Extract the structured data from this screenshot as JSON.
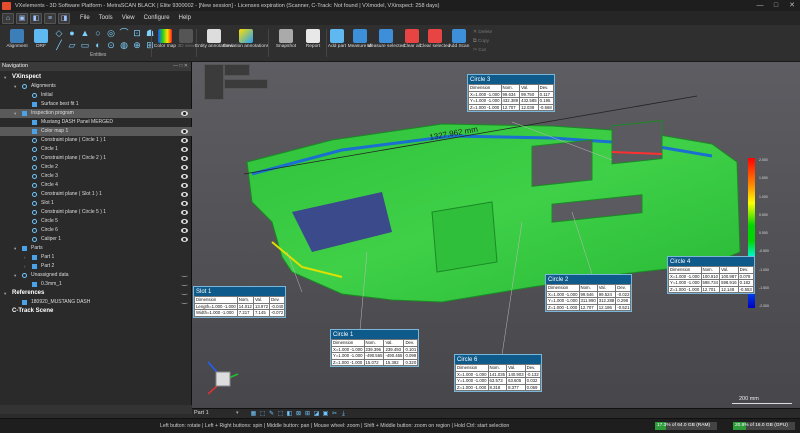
{
  "titlebar": {
    "title": "VXelements - 3D Software Platform - MetraSCAN BLACK | Elite 9300002 - [New session] - Licenses expiration (Scanner, C-Track: Not found | VXmodel, VXinspect: 258 days)",
    "minimize": "—",
    "maximize": "□",
    "close": "✕"
  },
  "menubar": {
    "items": [
      "File",
      "Tools",
      "View",
      "Configure",
      "Help"
    ],
    "quick": [
      "⌂",
      "▣",
      "◧",
      "≡",
      "◨"
    ]
  },
  "ribbon": {
    "alignment": "Alignment",
    "drf": "DRF",
    "entities_group": "Entities",
    "color_map": "Color map",
    "view_3d": "3D view",
    "entity_annotations": "Entity annotations",
    "deviation_annotations": "Deviation annotations",
    "snapshot": "Snapshot",
    "report": "Report",
    "add_part": "Add part",
    "measure_all": "Measure all",
    "measure_selected": "Measure selected",
    "clear_all": "Clear all",
    "clear_selected": "Clear selected",
    "add_scan": "Add Scan",
    "delete": "Delete",
    "copy": "Copy",
    "cut": "Cut",
    "entity_glyphs": [
      "◇",
      "●",
      "▲",
      "○",
      "◎",
      "⌒",
      "⊡",
      "☗",
      "╱",
      "▱",
      "▭",
      "◐",
      "⊙",
      "◍",
      "⊕",
      "⊞"
    ],
    "colors": {
      "accent": "#5fb8f0",
      "clear": "#e84444"
    }
  },
  "nav": {
    "header": "Navigation",
    "controls": "— □ ✕",
    "rows": [
      {
        "label": "VXinspect",
        "bold": true,
        "depth": 0,
        "arrow": "▾"
      },
      {
        "label": "Alignments",
        "depth": 1,
        "arrow": "▾",
        "icon": "dot"
      },
      {
        "label": "Initial",
        "depth": 2,
        "icon": "dot"
      },
      {
        "label": "Surface best fit 1",
        "depth": 2,
        "icon": "sq"
      },
      {
        "label": "Inspection program",
        "depth": 1,
        "arrow": "▾",
        "icon": "sq",
        "eye": "eye",
        "selected": true
      },
      {
        "label": "Mustang DASH Panel MERGED",
        "depth": 2,
        "icon": "sq"
      },
      {
        "label": "Color map 1",
        "depth": 2,
        "icon": "sq",
        "eye": "eye",
        "selected": true
      },
      {
        "label": "Constraint plane ( Circle 1 ) 1",
        "depth": 2,
        "icon": "dot",
        "eye": "eye"
      },
      {
        "label": "Circle 1",
        "depth": 2,
        "icon": "dot",
        "eye": "eye"
      },
      {
        "label": "Constraint plane ( Circle 2 ) 1",
        "depth": 2,
        "icon": "dot",
        "eye": "eye"
      },
      {
        "label": "Circle 2",
        "depth": 2,
        "icon": "dot",
        "eye": "eye"
      },
      {
        "label": "Circle 3",
        "depth": 2,
        "icon": "dot",
        "eye": "eye"
      },
      {
        "label": "Circle 4",
        "depth": 2,
        "icon": "dot",
        "eye": "eye"
      },
      {
        "label": "Constraint plane ( Slot 1 ) 1",
        "depth": 2,
        "icon": "dot",
        "eye": "eye"
      },
      {
        "label": "Slot 1",
        "depth": 2,
        "icon": "dot",
        "eye": "eye"
      },
      {
        "label": "Constraint plane ( Circle 5 ) 1",
        "depth": 2,
        "icon": "dot",
        "eye": "eye"
      },
      {
        "label": "Circle 5",
        "depth": 2,
        "icon": "dot",
        "eye": "eye"
      },
      {
        "label": "Circle 6",
        "depth": 2,
        "icon": "dot",
        "eye": "eye"
      },
      {
        "label": "Caliper 1",
        "depth": 2,
        "icon": "dot",
        "eye": "eye"
      },
      {
        "label": "Parts",
        "depth": 1,
        "arrow": "▾",
        "icon": "sq"
      },
      {
        "label": "Part 1",
        "depth": 2,
        "icon": "sq",
        "arrow": "›"
      },
      {
        "label": "Part 2",
        "depth": 2,
        "icon": "sq",
        "arrow": "›"
      },
      {
        "label": "Unassigned data",
        "depth": 1,
        "arrow": "▾",
        "icon": "dot",
        "eye": "hid"
      },
      {
        "label": "0.3mm_1",
        "depth": 2,
        "icon": "sq",
        "eye": "hid"
      },
      {
        "label": "References",
        "bold": true,
        "depth": 0,
        "arrow": "▾",
        "eye": "hid"
      },
      {
        "label": "180920_MUSTANG DASH",
        "depth": 1,
        "icon": "sq",
        "eye": "hid"
      },
      {
        "label": "C-Track Scene",
        "bold": true,
        "depth": 0
      }
    ]
  },
  "viewport": {
    "caliper_label": "1327.962 mm",
    "scale_bar_label": "200 mm",
    "color_scale": {
      "values": [
        "2.000",
        "1.500",
        "1.000",
        "0.500",
        "0.000",
        "-0.500",
        "-1.000",
        "-1.500",
        "-2.000"
      ]
    },
    "annotations": [
      {
        "name": "circle-3-box",
        "title": "Circle 3",
        "header": [
          "Dimension",
          "Nom.",
          "Val.",
          "Dev."
        ],
        "rows": [
          [
            "X=1.000 -1.000",
            "99.634",
            "99.750",
            "0.117"
          ],
          [
            "Y=1.000 -1.000",
            "432.389",
            "432.585",
            "0.195"
          ],
          [
            "Z=1.000 -1.000",
            "12.707",
            "12.039",
            "-0.668"
          ]
        ],
        "red": []
      },
      {
        "name": "circle-4-box",
        "title": "Circle 4",
        "header": [
          "Dimension",
          "Nom.",
          "Val.",
          "Dev."
        ],
        "rows": [
          [
            "X=1.000 -1.000",
            "100.910",
            "100.987",
            "0.078"
          ],
          [
            "Y=1.000 -1.000",
            "598.734",
            "598.916",
            "0.182"
          ],
          [
            "Z=1.000 -1.000",
            "12.701",
            "12.148",
            "-0.553"
          ]
        ],
        "red": []
      },
      {
        "name": "circle-2-box",
        "title": "Circle 2",
        "header": [
          "Dimension",
          "Nom.",
          "Val.",
          "Dev."
        ],
        "rows": [
          [
            "X=1.000 -1.000",
            "99.546",
            "99.524",
            "-0.022"
          ],
          [
            "Y=1.000 -1.000",
            "311.990",
            "312.288",
            "0.298"
          ],
          [
            "Z=1.000 -1.000",
            "12.707",
            "12.186",
            "-0.521"
          ]
        ],
        "red": []
      },
      {
        "name": "slot-1-box",
        "title": "Slot 1",
        "header": [
          "Dimension",
          "Nom.",
          "Val.",
          "Dev."
        ],
        "rows": [
          [
            "Length=1.000 -1.000",
            "14.012",
            "13.972",
            "-0.040"
          ],
          [
            "Width=1.000 -1.000",
            "7.217",
            "7.145",
            "-0.072"
          ]
        ],
        "red": []
      },
      {
        "name": "circle-1-box",
        "title": "Circle 1",
        "header": [
          "Dimension",
          "Nom.",
          "Val.",
          "Dev."
        ],
        "rows": [
          [
            "X=1.000 -1.000",
            "239.396",
            "239.493",
            "0.101"
          ],
          [
            "Y=1.000 -1.000",
            "-490.565",
            "-490.465",
            "0.099"
          ],
          [
            "Z=1.000 -1.000",
            "15.072",
            "15.392",
            "0.320"
          ]
        ],
        "red": []
      },
      {
        "name": "circle-6-box",
        "title": "Circle 6",
        "header": [
          "Dimension",
          "Nom.",
          "Val.",
          "Dev."
        ],
        "rows": [
          [
            "X=1.000 -1.000",
            "141.035",
            "140.903",
            "-0.132"
          ],
          [
            "Y=1.000 -1.000",
            "63.573",
            "63.605",
            "0.032"
          ],
          [
            "Z=1.000 -1.000",
            "8.318",
            "8.377",
            "0.059"
          ]
        ],
        "red": []
      }
    ]
  },
  "vpbar": {
    "part": "Part 1",
    "caret": "▾",
    "icons": [
      "▦",
      "⬚",
      "✎",
      "⬚",
      "◧",
      "⊠",
      "⊞",
      "◪",
      "▣",
      "✂",
      "⤓"
    ]
  },
  "status": {
    "hint": "Left button: rotate  |  Left + Right buttons: spin  |  Middle button: pan  |  Mouse wheel: zoom  |  Shift + Middle button: zoom on region  |  Hold Ctrl: start selection",
    "ram": {
      "text": "17.3% of 64.0 GB (RAM)",
      "fraction": 0.173
    },
    "gpu": {
      "text": "20.8% of 16.0 GB (GPU)",
      "fraction": 0.208
    },
    "mem_color": "#2d9b3a"
  }
}
